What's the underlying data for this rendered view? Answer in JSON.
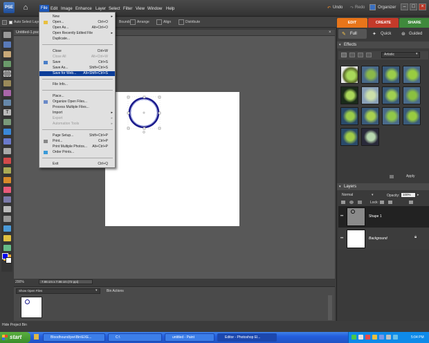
{
  "menubar": {
    "logo_text": "PSE",
    "items": [
      "File",
      "Edit",
      "Image",
      "Enhance",
      "Layer",
      "Select",
      "Filter",
      "View",
      "Window",
      "Help"
    ],
    "undo": "Undo",
    "redo": "Redo",
    "organizer": "Organizer"
  },
  "options_bar": {
    "auto_select": "Auto Select Layer",
    "arrange": "Arrange",
    "align": "Align",
    "distribute": "Distribute"
  },
  "modes": {
    "edit": "EDIT",
    "create": "CREATE",
    "share": "SHARE"
  },
  "document": {
    "tab_title": "Untitled-1.psd",
    "zoom": "200%",
    "dimensions": "7.86 cm x 7.86 cm (72 ppi)"
  },
  "file_menu": {
    "items": [
      {
        "label": "New",
        "shortcut": "",
        "arrow": true,
        "disabled": false
      },
      {
        "label": "Open...",
        "shortcut": "Ctrl+O",
        "arrow": false,
        "disabled": false
      },
      {
        "label": "Open As...",
        "shortcut": "Alt+Ctrl+O",
        "arrow": false,
        "disabled": false
      },
      {
        "label": "Open Recently Edited File",
        "shortcut": "",
        "arrow": true,
        "disabled": false
      },
      {
        "label": "Duplicate...",
        "shortcut": "",
        "arrow": false,
        "disabled": false
      },
      {
        "label": "Close",
        "shortcut": "Ctrl+W",
        "arrow": false,
        "disabled": false
      },
      {
        "label": "Close All",
        "shortcut": "Alt+Ctrl+W",
        "arrow": false,
        "disabled": true
      },
      {
        "label": "Save",
        "shortcut": "Ctrl+S",
        "arrow": false,
        "disabled": false
      },
      {
        "label": "Save As...",
        "shortcut": "Shift+Ctrl+S",
        "arrow": false,
        "disabled": false
      },
      {
        "label": "Save for Web...",
        "shortcut": "Alt+Shift+Ctrl+S",
        "arrow": false,
        "disabled": false,
        "selected": true
      },
      {
        "label": "File Info...",
        "shortcut": "",
        "arrow": false,
        "disabled": false
      },
      {
        "label": "Place...",
        "shortcut": "",
        "arrow": false,
        "disabled": false
      },
      {
        "label": "Organize Open Files...",
        "shortcut": "",
        "arrow": false,
        "disabled": false
      },
      {
        "label": "Process Multiple Files...",
        "shortcut": "",
        "arrow": false,
        "disabled": false
      },
      {
        "label": "Import",
        "shortcut": "",
        "arrow": true,
        "disabled": false
      },
      {
        "label": "Export",
        "shortcut": "",
        "arrow": true,
        "disabled": true
      },
      {
        "label": "Automation Tools",
        "shortcut": "",
        "arrow": true,
        "disabled": true
      },
      {
        "label": "Page Setup...",
        "shortcut": "Shift+Ctrl+P",
        "arrow": false,
        "disabled": false
      },
      {
        "label": "Print...",
        "shortcut": "Ctrl+P",
        "arrow": false,
        "disabled": false
      },
      {
        "label": "Print Multiple Photos...",
        "shortcut": "Alt+Ctrl+P",
        "arrow": false,
        "disabled": false
      },
      {
        "label": "Order Prints...",
        "shortcut": "",
        "arrow": false,
        "disabled": false
      },
      {
        "label": "Exit",
        "shortcut": "Ctrl+Q",
        "arrow": false,
        "disabled": false
      }
    ]
  },
  "right_panel": {
    "tabs": [
      "Full",
      "Quick",
      "Guided"
    ],
    "effects_title": "Effects",
    "effects_filter": "Artistic",
    "apply": "Apply",
    "layers_title": "Layers",
    "blend_mode": "Normal",
    "opacity_label": "Opacity:",
    "opacity_value": "100%",
    "lock_label": "Lock:",
    "layers": [
      {
        "name": "Shape 1",
        "selected": true
      },
      {
        "name": "Background",
        "selected": false
      }
    ]
  },
  "project_bin": {
    "dropdown": "Show Open Files",
    "bin_actions": "Bin Actions",
    "hide": "Hide Project Bin"
  },
  "taskbar": {
    "start": "start",
    "tasks": [
      {
        "label": "Bloodhound/pre\\Bin\\EXE...",
        "active": false
      },
      {
        "label": "C:\\",
        "active": false
      },
      {
        "label": "untitled - Paint",
        "active": false
      },
      {
        "label": "Editor - Photoshop El...",
        "active": true
      }
    ],
    "clock": "5:04 PM"
  },
  "colors": {
    "menu_highlight": "#1d57b8",
    "edit_tab": "#e8751a",
    "create_tab": "#c43a2a",
    "share_tab": "#3f8a3c",
    "circle_stroke": "#1a1a8c"
  }
}
